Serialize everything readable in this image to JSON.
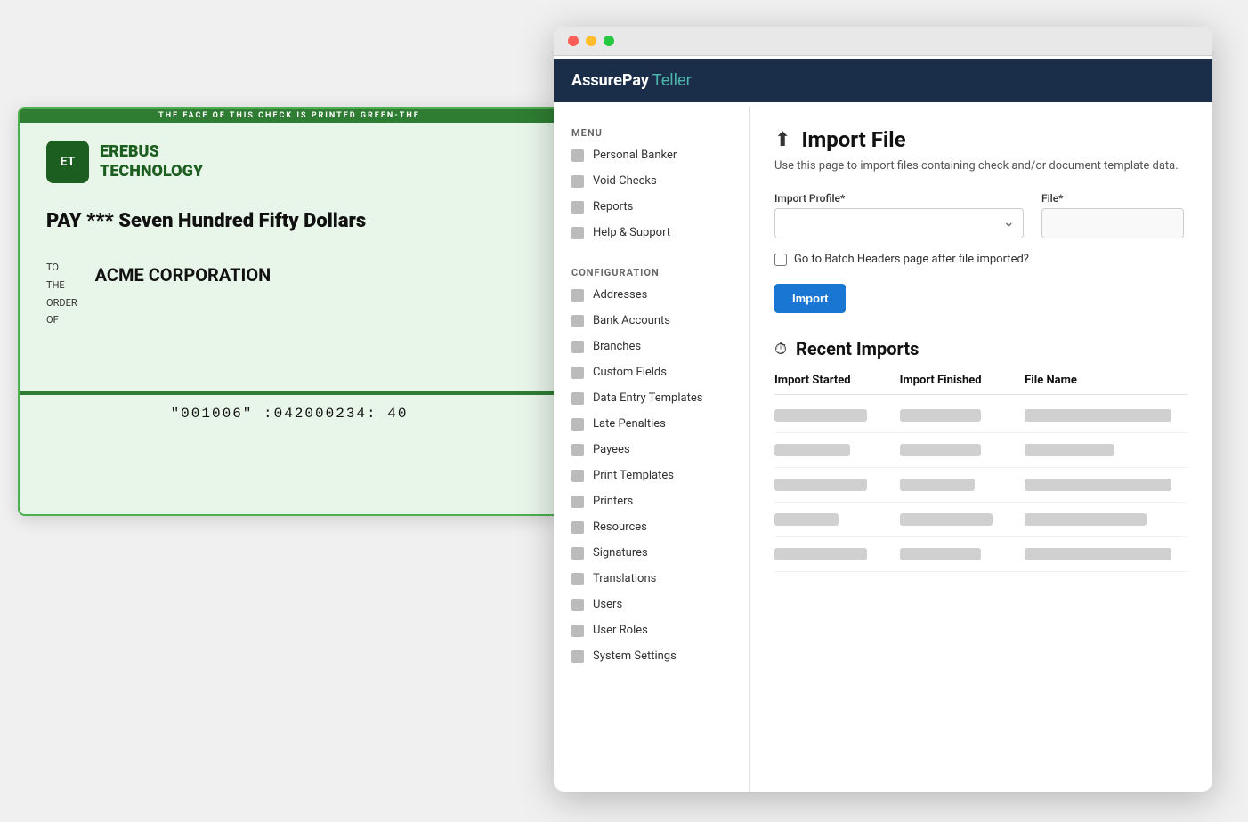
{
  "check": {
    "security_strip": "THE FACE OF THIS CHECK IS PRINTED GREEN-THE",
    "logo_initials": "ET",
    "company_name_line1": "EREBUS",
    "company_name_line2": "TECHNOLOGY",
    "amount_text": "PAY *** Seven Hundred Fifty Dollars",
    "to_label_lines": [
      "TO",
      "THE",
      "ORDER",
      "OF"
    ],
    "payee_name": "ACME CORPORATION",
    "micr": "\"001006\"  :042000234:  40"
  },
  "browser": {
    "dot_colors": [
      "red",
      "yellow",
      "green"
    ]
  },
  "app": {
    "title_assure": "AssurePay",
    "title_teller": " Teller"
  },
  "sidebar": {
    "menu_label": "MENU",
    "menu_items": [
      {
        "label": "Personal Banker"
      },
      {
        "label": "Void Checks"
      },
      {
        "label": "Reports"
      },
      {
        "label": "Help & Support"
      }
    ],
    "config_label": "CONFIGURATION",
    "config_items": [
      {
        "label": "Addresses"
      },
      {
        "label": "Bank Accounts"
      },
      {
        "label": "Branches"
      },
      {
        "label": "Custom Fields"
      },
      {
        "label": "Data Entry Templates"
      },
      {
        "label": "Late Penalties"
      },
      {
        "label": "Payees"
      },
      {
        "label": "Print Templates"
      },
      {
        "label": "Printers"
      },
      {
        "label": "Resources"
      },
      {
        "label": "Signatures"
      },
      {
        "label": "Translations"
      },
      {
        "label": "Users"
      },
      {
        "label": "User Roles"
      },
      {
        "label": "System Settings"
      }
    ]
  },
  "main": {
    "page_title": "Import File",
    "page_description": "Use this page to import files containing check and/or document template data.",
    "import_profile_label": "Import Profile*",
    "file_label": "File*",
    "checkbox_label": "Go to Batch Headers page after file imported?",
    "import_button_label": "Import",
    "recent_imports_title": "Recent Imports",
    "table_headers": {
      "import_started": "Import Started",
      "import_finished": "Import Finished",
      "file_name": "File Name"
    },
    "recent_rows": [
      {
        "started_class": "short",
        "finished_class": "medium",
        "filename_class": "long"
      },
      {
        "started_class": "varied1",
        "finished_class": "medium",
        "filename_class": "varied2"
      },
      {
        "started_class": "short",
        "finished_class": "varied1",
        "filename_class": "long"
      },
      {
        "started_class": "varied2",
        "finished_class": "short",
        "filename_class": "varied3"
      },
      {
        "started_class": "short",
        "finished_class": "medium",
        "filename_class": "long"
      }
    ]
  }
}
